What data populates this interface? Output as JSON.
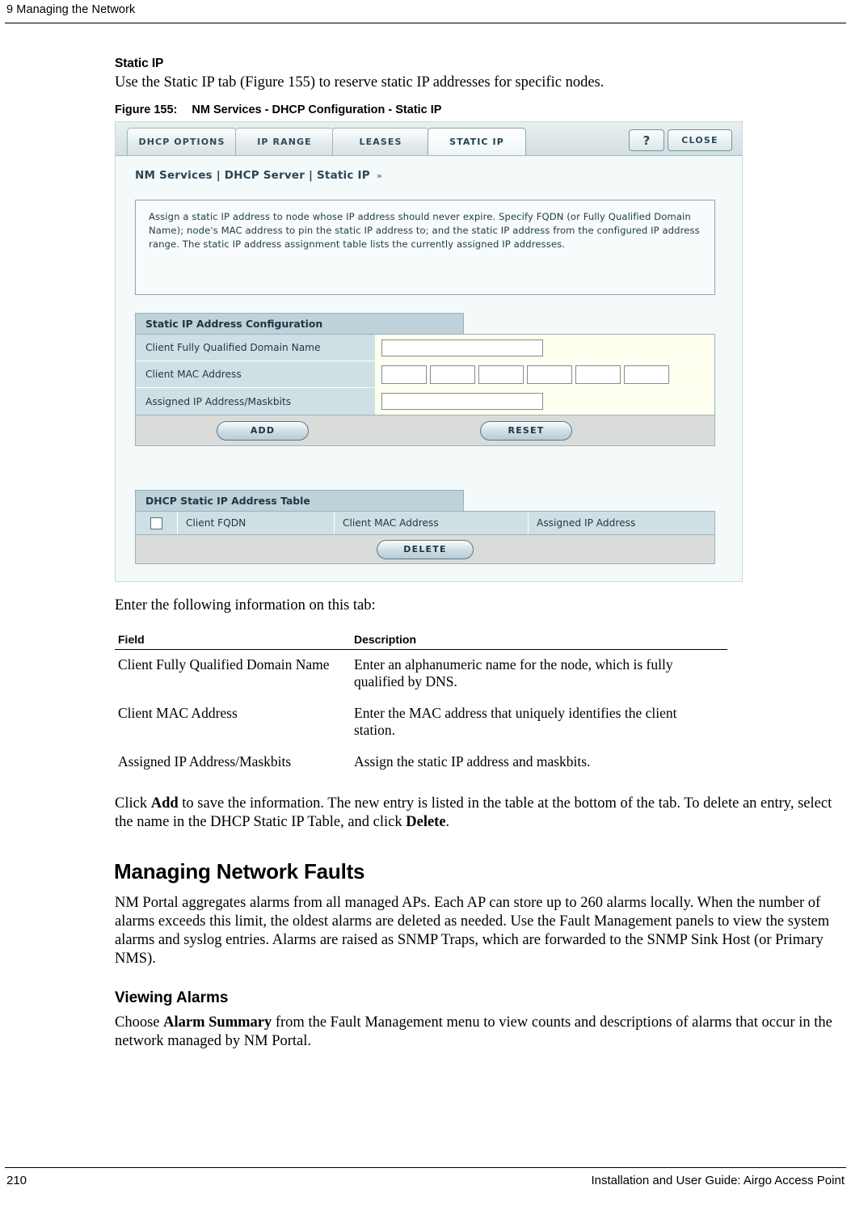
{
  "header": {
    "chapter": "9  Managing the Network"
  },
  "footer": {
    "page_number": "210",
    "guide_title": "Installation and User Guide: Airgo Access Point"
  },
  "section": {
    "title": "Static IP",
    "intro": "Use the Static IP tab (Figure 155) to reserve static IP addresses for specific nodes.",
    "figure_label": "Figure 155:",
    "figure_title": "NM Services - DHCP Configuration - Static IP",
    "after_figure": "Enter the following information on this tab:"
  },
  "screenshot": {
    "tabs": [
      {
        "label": "DHCP OPTIONS",
        "active": false
      },
      {
        "label": "IP RANGE",
        "active": false
      },
      {
        "label": "LEASES",
        "active": false
      },
      {
        "label": "STATIC IP",
        "active": true
      }
    ],
    "help_label": "?",
    "close_label": "CLOSE",
    "breadcrumb": "NM Services | DHCP Server | Static IP",
    "breadcrumb_mark": "»",
    "description": "Assign a static IP address to node whose IP address should never expire. Specify FQDN (or Fully Qualified Domain Name); node's MAC address to pin the static IP address to; and the static IP address from the configured IP address range. The static IP address assignment table lists the currently assigned IP addresses.",
    "config_panel": {
      "title": "Static IP Address Configuration",
      "rows": [
        {
          "label": "Client Fully Qualified Domain Name",
          "value": "",
          "type": "text"
        },
        {
          "label": "Client MAC Address",
          "value": "",
          "type": "mac"
        },
        {
          "label": "Assigned IP Address/Maskbits",
          "value": "",
          "type": "text"
        }
      ],
      "add_label": "ADD",
      "reset_label": "RESET"
    },
    "table_panel": {
      "title": "DHCP Static IP Address Table",
      "columns": [
        "Client FQDN",
        "Client MAC Address",
        "Assigned IP Address"
      ],
      "rows": [],
      "delete_label": "DELETE"
    }
  },
  "field_table": {
    "headers": [
      "Field",
      "Description"
    ],
    "rows": [
      {
        "field": "Client Fully Qualified Domain Name",
        "description": "Enter an alphanumeric name for the node, which is fully qualified by DNS."
      },
      {
        "field": "Client MAC Address",
        "description": "Enter the MAC address that uniquely identifies the client station."
      },
      {
        "field": "Assigned IP Address/Maskbits",
        "description": "Assign the static IP address and maskbits."
      }
    ]
  },
  "after_table": {
    "part1": "Click ",
    "bold1": "Add",
    "part2": " to save the information. The new entry is listed in the table at the bottom of the tab. To delete an entry, select the name in the DHCP Static IP Table, and click ",
    "bold2": "Delete",
    "part3": "."
  },
  "faults": {
    "heading": "Managing Network Faults",
    "paragraph": "NM Portal aggregates alarms from all managed APs. Each AP can store up to 260 alarms locally. When the number of alarms exceeds this limit, the oldest alarms are deleted as needed. Use the Fault Management panels to view the system alarms and syslog entries. Alarms are raised as SNMP Traps, which are forwarded to the SNMP Sink Host (or Primary NMS)."
  },
  "viewing_alarms": {
    "heading": "Viewing Alarms",
    "part1": "Choose ",
    "bold1": "Alarm Summary",
    "part2": " from the Fault Management menu to view counts and descriptions of alarms that occur in the network managed by NM Portal."
  }
}
